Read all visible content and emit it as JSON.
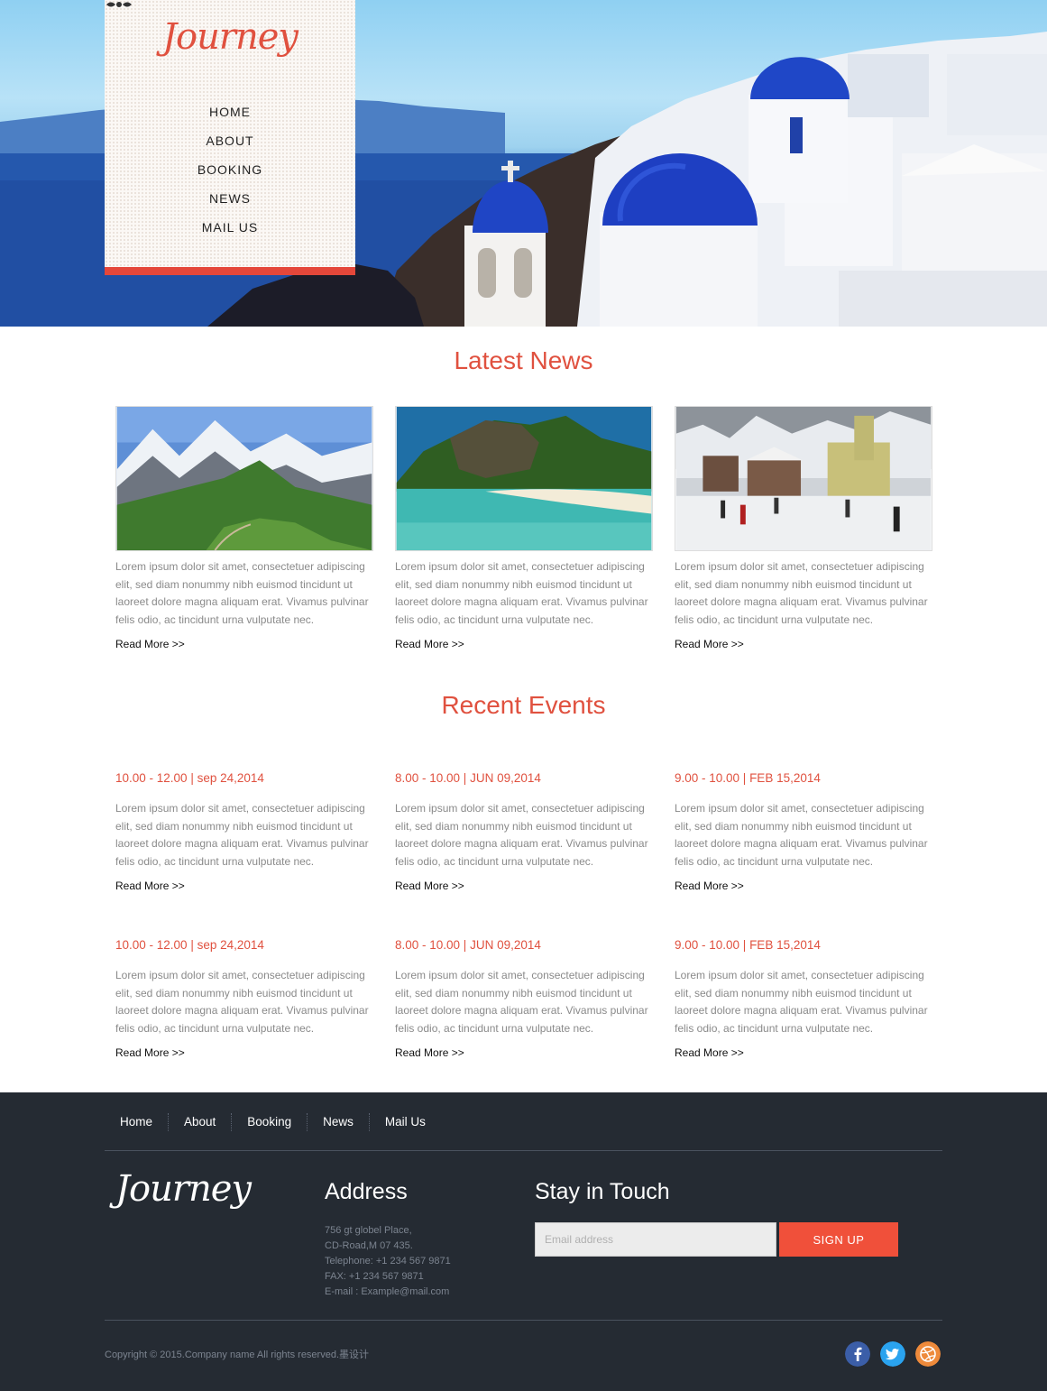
{
  "header": {
    "logo": "Journey",
    "menu": [
      {
        "label": "HOME"
      },
      {
        "label": "ABOUT"
      },
      {
        "label": "BOOKING"
      },
      {
        "label": "NEWS"
      },
      {
        "label": "MAIL US"
      }
    ]
  },
  "news": {
    "title": "Latest News",
    "items": [
      {
        "text": "Lorem ipsum dolor sit amet, consectetuer adipiscing elit, sed diam nonummy nibh euismod tincidunt ut laoreet dolore magna aliquam erat. Vivamus pulvinar felis odio, ac tincidunt urna vulputate nec.",
        "more": "Read More >>"
      },
      {
        "text": "Lorem ipsum dolor sit amet, consectetuer adipiscing elit, sed diam nonummy nibh euismod tincidunt ut laoreet dolore magna aliquam erat. Vivamus pulvinar felis odio, ac tincidunt urna vulputate nec.",
        "more": "Read More >>"
      },
      {
        "text": "Lorem ipsum dolor sit amet, consectetuer adipiscing elit, sed diam nonummy nibh euismod tincidunt ut laoreet dolore magna aliquam erat. Vivamus pulvinar felis odio, ac tincidunt urna vulputate nec.",
        "more": "Read More >>"
      }
    ]
  },
  "events": {
    "title": "Recent Events",
    "items": [
      {
        "date": "10.00 - 12.00 | sep 24,2014",
        "text": "Lorem ipsum dolor sit amet, consectetuer adipiscing elit, sed diam nonummy nibh euismod tincidunt ut laoreet dolore magna aliquam erat. Vivamus pulvinar felis odio, ac tincidunt urna vulputate nec.",
        "more": "Read More >>"
      },
      {
        "date": "8.00 - 10.00 | JUN 09,2014",
        "text": "Lorem ipsum dolor sit amet, consectetuer adipiscing elit, sed diam nonummy nibh euismod tincidunt ut laoreet dolore magna aliquam erat. Vivamus pulvinar felis odio, ac tincidunt urna vulputate nec.",
        "more": "Read More >>"
      },
      {
        "date": "9.00 - 10.00 | FEB 15,2014",
        "text": "Lorem ipsum dolor sit amet, consectetuer adipiscing elit, sed diam nonummy nibh euismod tincidunt ut laoreet dolore magna aliquam erat. Vivamus pulvinar felis odio, ac tincidunt urna vulputate nec.",
        "more": "Read More >>"
      },
      {
        "date": "10.00 - 12.00 | sep 24,2014",
        "text": "Lorem ipsum dolor sit amet, consectetuer adipiscing elit, sed diam nonummy nibh euismod tincidunt ut laoreet dolore magna aliquam erat. Vivamus pulvinar felis odio, ac tincidunt urna vulputate nec.",
        "more": "Read More >>"
      },
      {
        "date": "8.00 - 10.00 | JUN 09,2014",
        "text": "Lorem ipsum dolor sit amet, consectetuer adipiscing elit, sed diam nonummy nibh euismod tincidunt ut laoreet dolore magna aliquam erat. Vivamus pulvinar felis odio, ac tincidunt urna vulputate nec.",
        "more": "Read More >>"
      },
      {
        "date": "9.00 - 10.00 | FEB 15,2014",
        "text": "Lorem ipsum dolor sit amet, consectetuer adipiscing elit, sed diam nonummy nibh euismod tincidunt ut laoreet dolore magna aliquam erat. Vivamus pulvinar felis odio, ac tincidunt urna vulputate nec.",
        "more": "Read More >>"
      }
    ]
  },
  "footer": {
    "nav": [
      {
        "label": "Home"
      },
      {
        "label": "About"
      },
      {
        "label": "Booking"
      },
      {
        "label": "News"
      },
      {
        "label": "Mail Us"
      }
    ],
    "logo": "Journey",
    "address_title": "Address",
    "address_lines": [
      "756 gt globel Place,",
      "CD-Road,M 07 435.",
      "Telephone: +1 234 567 9871",
      "FAX: +1 234 567 9871",
      "E-mail : Example@mail.com"
    ],
    "touch_title": "Stay in Touch",
    "email_placeholder": "Email address",
    "signup_label": "SIGN UP",
    "copyright": "Copyright © 2015.Company name All rights reserved.墨设计",
    "social": [
      {
        "icon": "facebook-icon",
        "color": "#3b5ea8"
      },
      {
        "icon": "twitter-icon",
        "color": "#2aa3ef"
      },
      {
        "icon": "dribbble-icon",
        "color": "#ee8a3b"
      }
    ]
  },
  "colors": {
    "accent": "#e0513f",
    "footer_bg": "#252b33",
    "signup": "#f0503a"
  }
}
